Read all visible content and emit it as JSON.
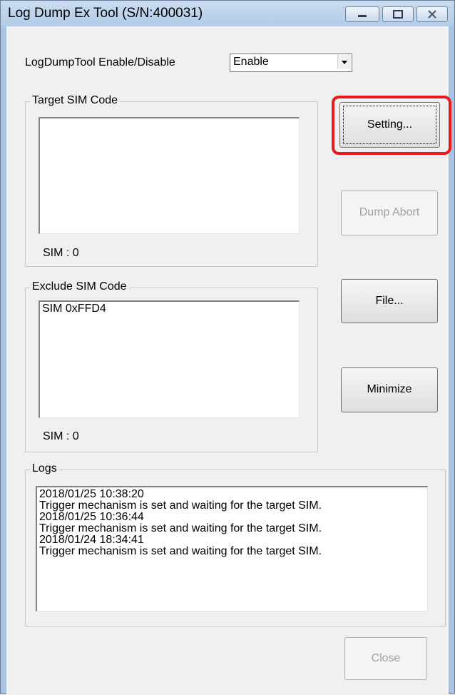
{
  "window": {
    "title": "Log Dump Ex Tool (S/N:400031)"
  },
  "enable_row": {
    "label": "LogDumpTool Enable/Disable",
    "selected": "Enable"
  },
  "target_sim": {
    "group_title": "Target SIM Code",
    "items": [],
    "count_label": "SIM : 0"
  },
  "exclude_sim": {
    "group_title": "Exclude SIM Code",
    "items": [
      "SIM 0xFFD4"
    ],
    "count_label": "SIM : 0"
  },
  "logs": {
    "group_title": "Logs",
    "lines": [
      "2018/01/25 10:38:20",
      "Trigger mechanism is set and waiting for the target SIM.",
      "2018/01/25 10:36:44",
      "Trigger mechanism is set and waiting for the target SIM.",
      "2018/01/24 18:34:41",
      "Trigger mechanism is set and waiting for the target SIM."
    ]
  },
  "buttons": {
    "setting": "Setting...",
    "dump_abort": "Dump Abort",
    "file": "File...",
    "minimize": "Minimize",
    "close": "Close"
  },
  "icons": {
    "minimize": "minimize-icon",
    "maximize": "maximize-icon",
    "close": "close-icon",
    "dropdown": "chevron-down-icon"
  },
  "colors": {
    "highlight": "#e8191f",
    "titlebar": "#b9cfe8",
    "disabled_text": "#a0a0a0"
  }
}
